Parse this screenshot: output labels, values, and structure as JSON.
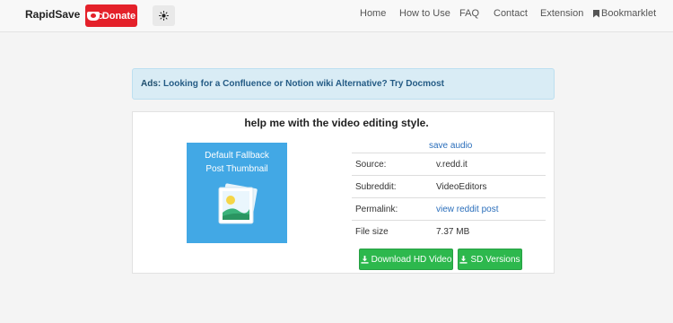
{
  "navbar": {
    "brand": "RapidSave",
    "donate_label": "Donate",
    "links": {
      "home": "Home",
      "how_to_use": "How to Use",
      "faq": "FAQ",
      "contact": "Contact",
      "extension": "Extension",
      "bookmarklet": "Bookmarklet"
    }
  },
  "ads": {
    "label": "Ads:",
    "link_text": "Looking for a Confluence or Notion wiki Alternative? Try Docmost"
  },
  "post": {
    "title": "help me with the video editing style.",
    "thumbnail_text": "Default Fallback\nPost Thumbnail",
    "save_audio": "save audio",
    "details": {
      "source_label": "Source:",
      "source_value": "v.redd.it",
      "subreddit_label": "Subreddit:",
      "subreddit_value": "VideoEditors",
      "permalink_label": "Permalink:",
      "permalink_value": "view reddit post",
      "filesize_label": "File size",
      "filesize_value": "7.37 MB"
    },
    "buttons": {
      "download_hd": "Download HD Video",
      "sd_versions": "SD Versions"
    }
  },
  "colors": {
    "donate": "#e4212a",
    "ads_bg": "#d9ecf5",
    "thumbnail_bg": "#42a8e5",
    "button_green": "#2db84d",
    "link": "#2a6ebb"
  },
  "icons": [
    "kofi-cup-icon",
    "sun-icon",
    "bookmark-icon",
    "image-placeholder-icon",
    "download-icon"
  ]
}
